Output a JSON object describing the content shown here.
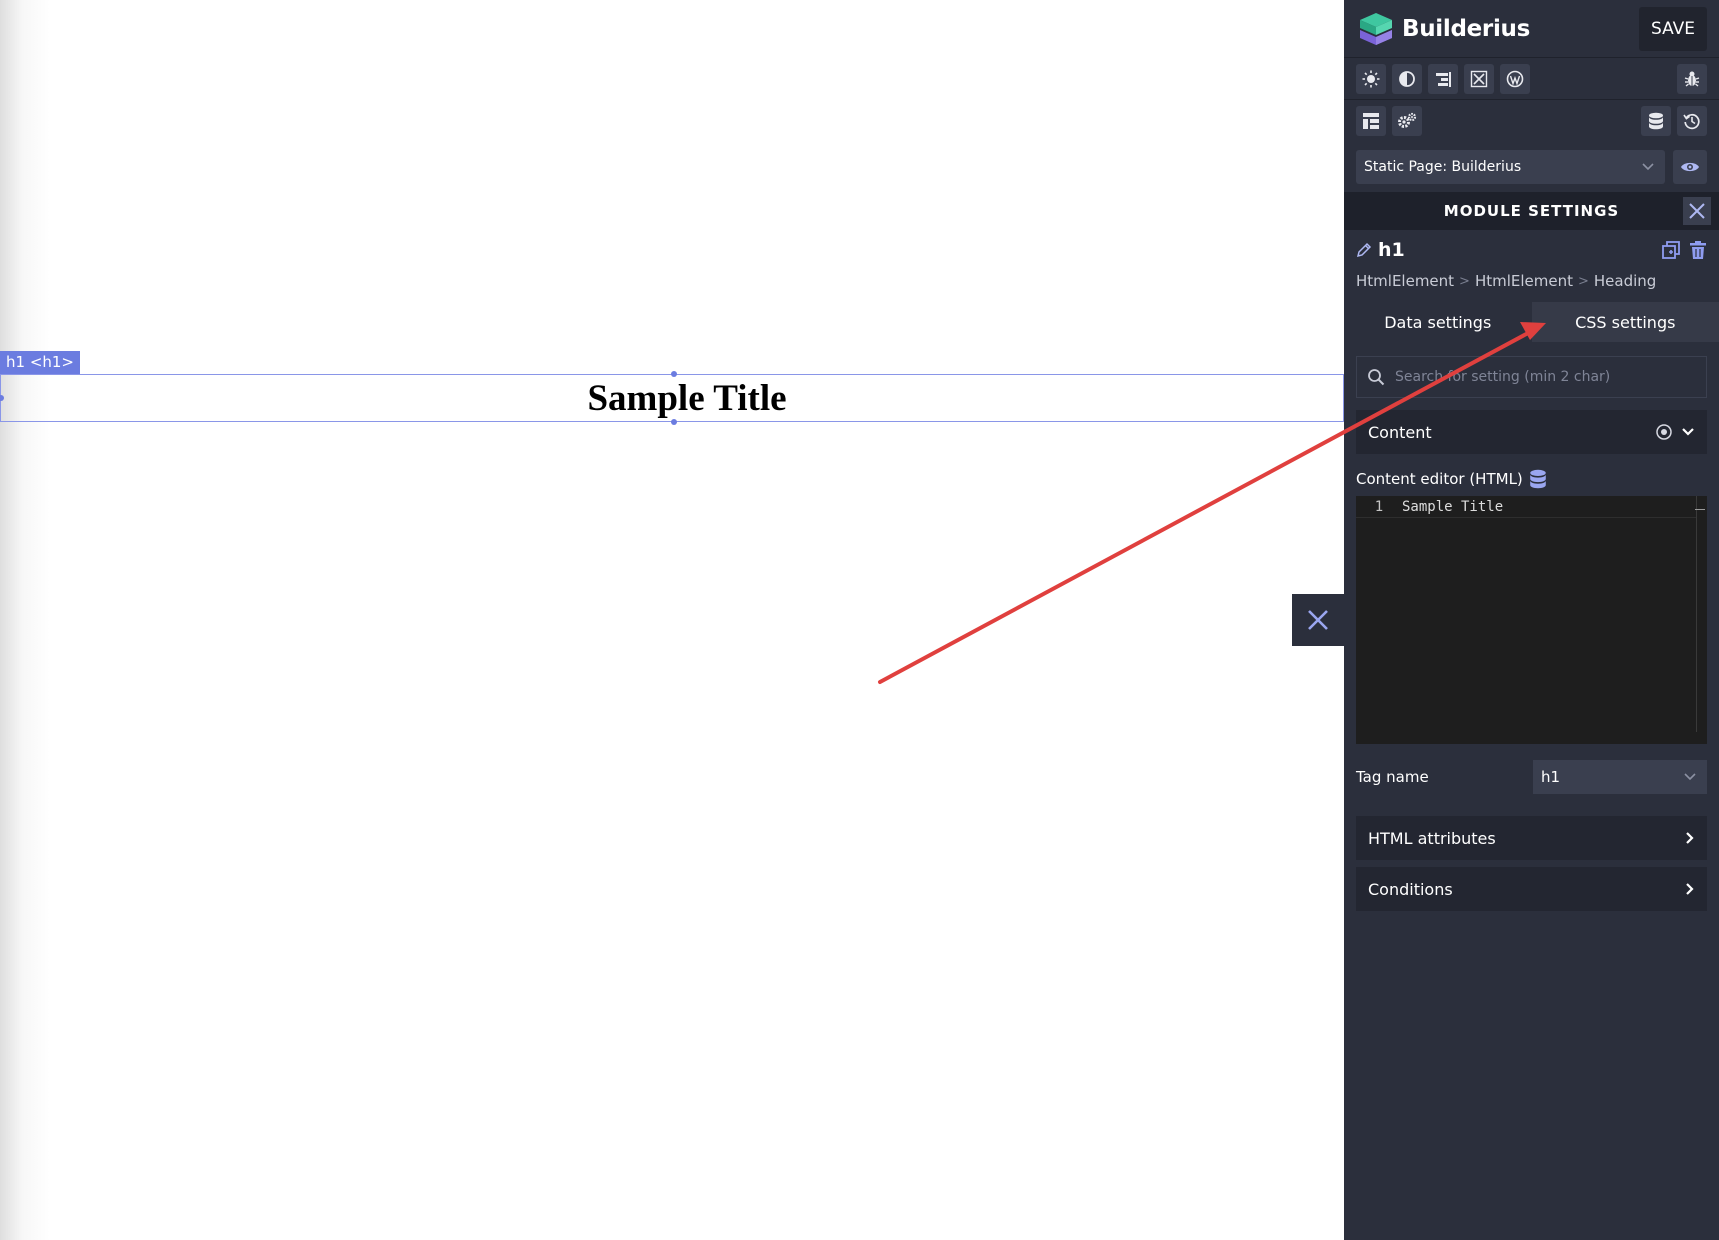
{
  "canvas": {
    "element_tag": "h1 <h1>",
    "heading_text": "Sample Title"
  },
  "panel": {
    "brand_name": "Builderius",
    "save_label": "SAVE",
    "toolbar_icons": [
      "sun-icon",
      "contrast-icon",
      "align-right-icon",
      "expand-icon",
      "wordpress-icon",
      "bug-icon"
    ],
    "toolbar2_icons": [
      "layout-icon",
      "gears-icon",
      "database-icon",
      "history-icon"
    ],
    "page_select_value": "Static Page: Builderius",
    "module_settings_title": "MODULE SETTINGS",
    "element_name": "h1",
    "breadcrumb": [
      "HtmlElement",
      "HtmlElement",
      "Heading"
    ],
    "breadcrumb_sep": ">",
    "tabs": [
      {
        "label": "Data settings",
        "active": true
      },
      {
        "label": "CSS settings",
        "active": false
      }
    ],
    "search_placeholder": "Search for setting (min 2 char)",
    "content_section": "Content",
    "content_editor_label": "Content editor (HTML)",
    "editor_lines": [
      {
        "no": "1",
        "text": "Sample Title"
      }
    ],
    "tag_name_label": "Tag name",
    "tag_name_value": "h1",
    "html_attributes_label": "HTML attributes",
    "conditions_label": "Conditions"
  },
  "colors": {
    "panel_bg": "#2b2f3c",
    "accent": "#6b7ce0",
    "annotation_arrow": "#e0403e",
    "brand_green": "#3fc7a0",
    "brand_purple": "#7a63d8"
  }
}
